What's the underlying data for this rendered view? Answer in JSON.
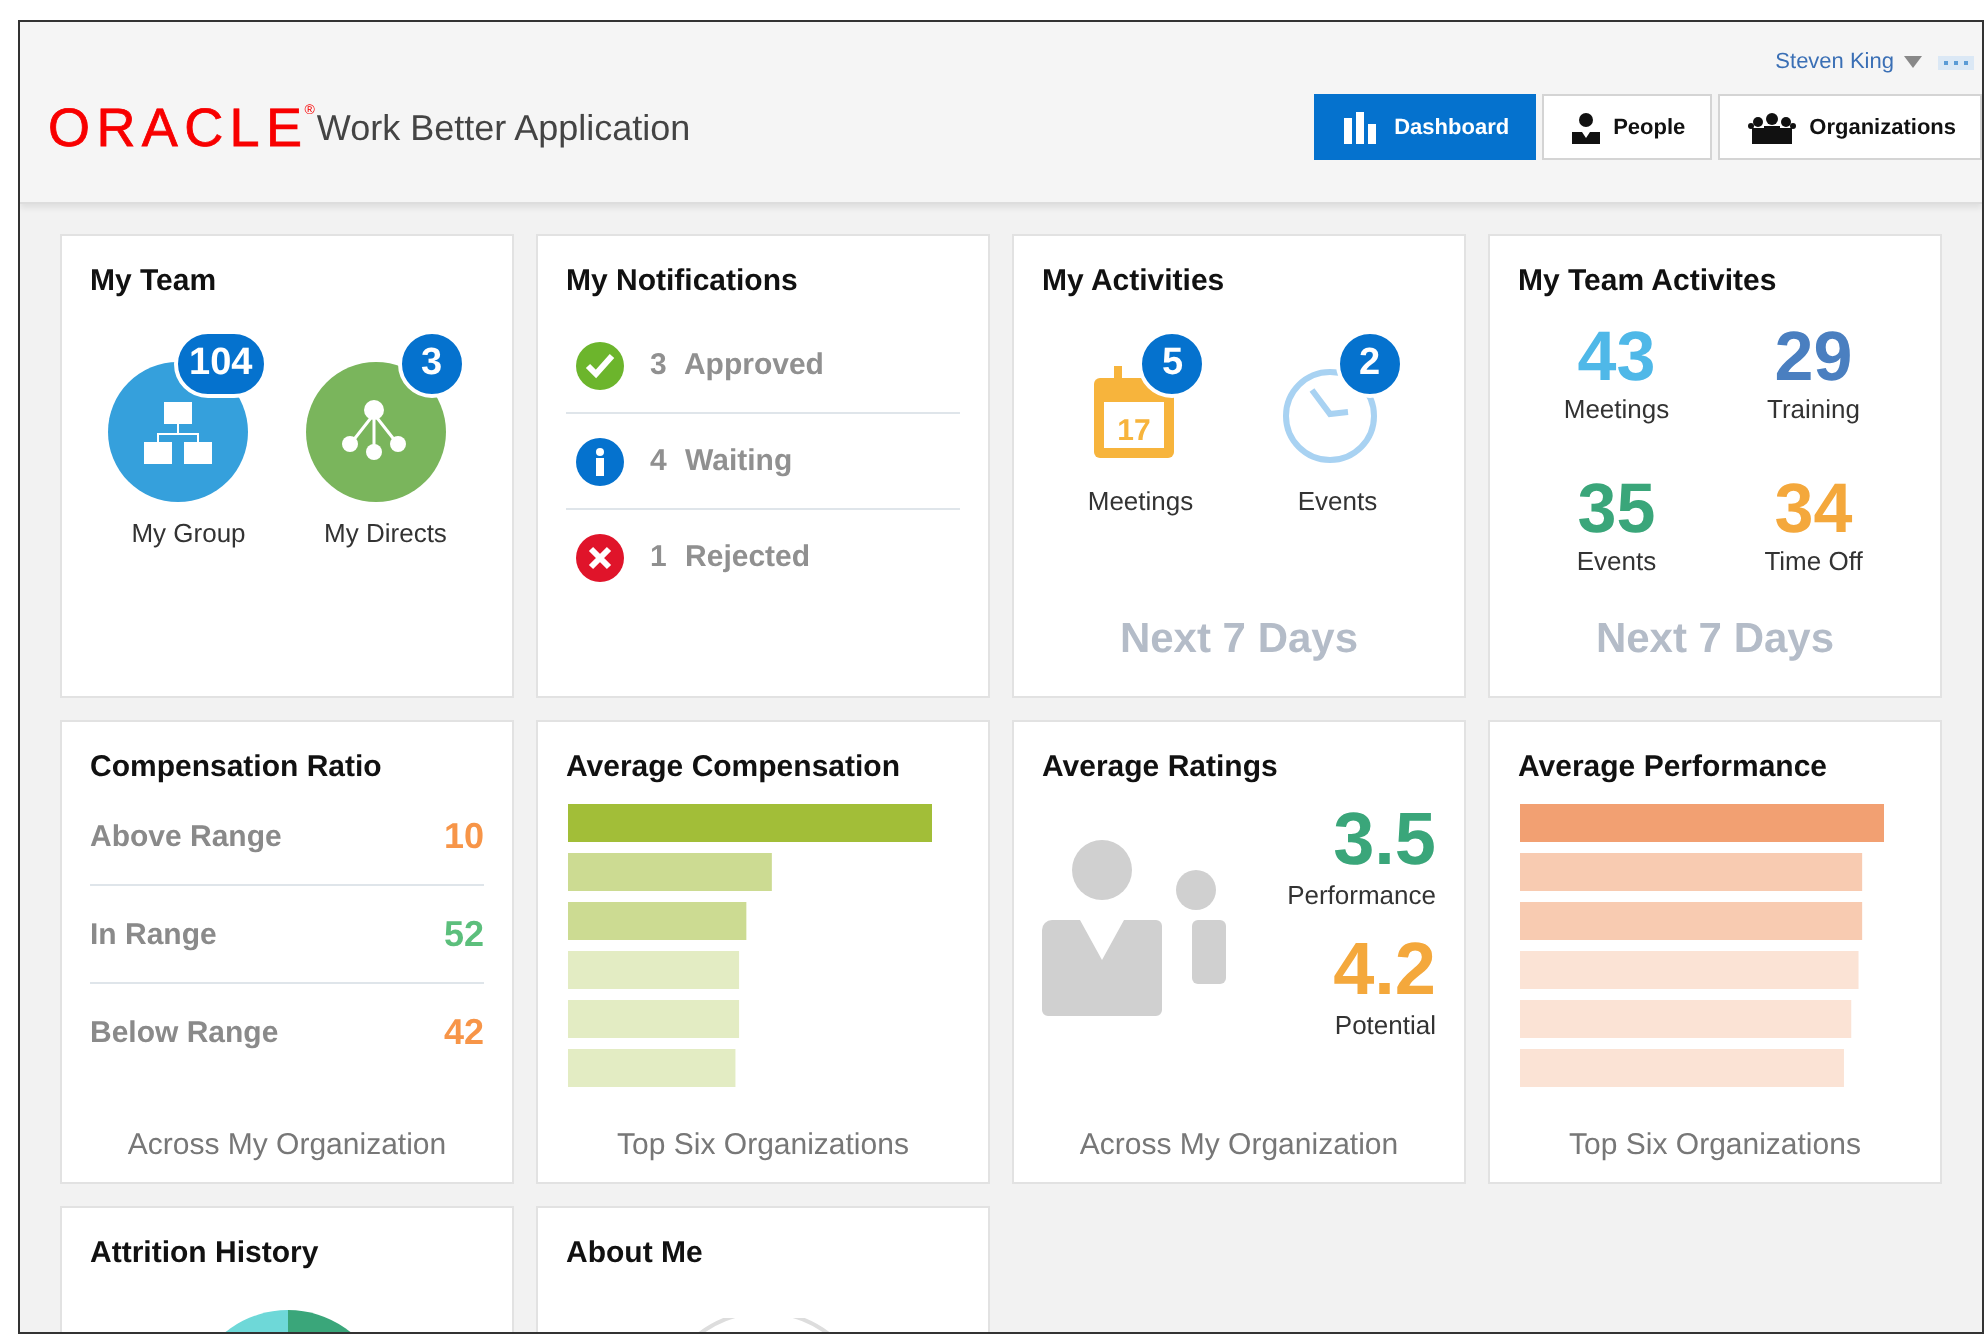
{
  "header": {
    "logo": "ORACLE",
    "trademark": "®",
    "app_title": "Work Better Application",
    "user": "Steven King",
    "nav": [
      {
        "label": "Dashboard",
        "kind": "dashboard",
        "selected": true
      },
      {
        "label": "People",
        "kind": "people",
        "selected": false
      },
      {
        "label": "Organizations",
        "kind": "organizations",
        "selected": false
      }
    ]
  },
  "cards": [
    {
      "kind": "team",
      "title": "My Team",
      "items": [
        {
          "label": "My Group",
          "badge": "104",
          "kind": "group"
        },
        {
          "label": "My Directs",
          "badge": "3",
          "kind": "directs"
        }
      ]
    },
    {
      "kind": "notifications",
      "title": "My Notifications",
      "items": [
        {
          "kind": "approved",
          "count": "3",
          "label": "Approved"
        },
        {
          "kind": "waiting",
          "count": "4",
          "label": "Waiting"
        },
        {
          "kind": "rejected",
          "count": "1",
          "label": "Rejected"
        }
      ]
    },
    {
      "kind": "activities",
      "title": "My Activities",
      "items": [
        {
          "kind": "calendar",
          "badge": "5",
          "label": "Meetings",
          "date": "17"
        },
        {
          "kind": "clock",
          "badge": "2",
          "label": "Events"
        }
      ],
      "footer": "Next 7 Days"
    },
    {
      "kind": "team_activities",
      "title": "My Team Activites",
      "items": [
        {
          "value": "43",
          "label": "Meetings",
          "color": "#4fb8e8"
        },
        {
          "value": "29",
          "label": "Training",
          "color": "#4a7fc0"
        },
        {
          "value": "35",
          "label": "Events",
          "color": "#3aa67a"
        },
        {
          "value": "34",
          "label": "Time Off",
          "color": "#f4a83c"
        }
      ],
      "footer": "Next 7 Days"
    },
    {
      "kind": "ratio",
      "title": "Compensation Ratio",
      "items": [
        {
          "label": "Above Range",
          "value": "10",
          "color": "#f79548"
        },
        {
          "label": "In Range",
          "value": "52",
          "color": "#5cbf7c"
        },
        {
          "label": "Below Range",
          "value": "42",
          "color": "#f79548"
        }
      ],
      "footer": "Across My Organization"
    },
    {
      "kind": "bars",
      "title": "Average Compensation",
      "color": "#a2be38",
      "footer": "Top Six Organizations"
    },
    {
      "kind": "ratings",
      "title": "Average Ratings",
      "items": [
        {
          "value": "3.5",
          "label": "Performance",
          "color": "#3aa67a"
        },
        {
          "value": "4.2",
          "label": "Potential",
          "color": "#f4a83c"
        }
      ],
      "footer": "Across My Organization"
    },
    {
      "kind": "bars",
      "title": "Average Performance",
      "color": "#f2a072",
      "footer": "Top Six Organizations"
    },
    {
      "kind": "attrition",
      "title": "Attrition History"
    },
    {
      "kind": "about",
      "title": "About Me"
    }
  ]
}
